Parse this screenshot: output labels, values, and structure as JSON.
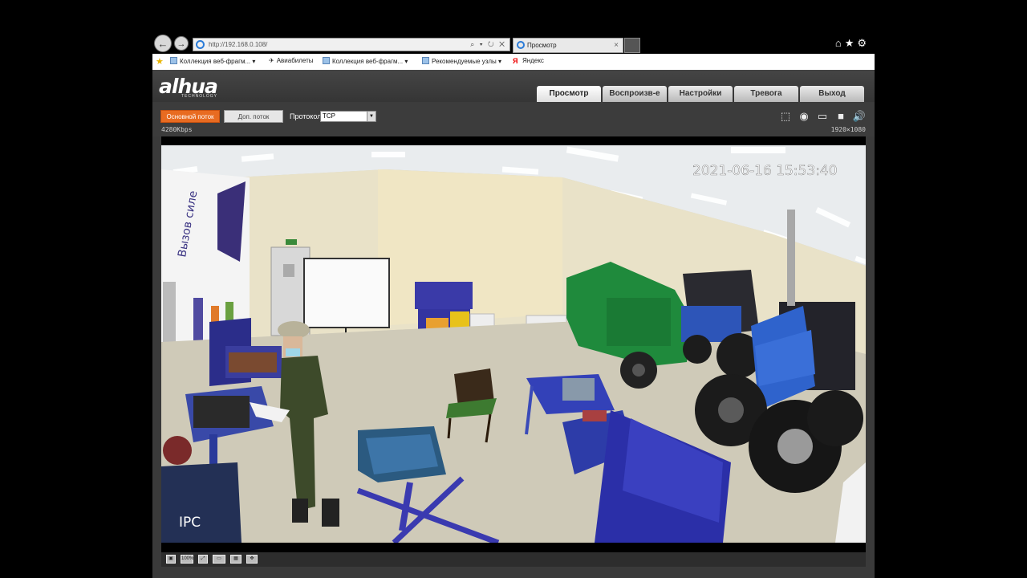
{
  "browser": {
    "url": "http://192.168.0.108/",
    "address_tools": "⌕ ▾ ↻ ✕",
    "tab_title": "Просмотр",
    "tab_close": "×",
    "back_icon": "←",
    "forward_icon": "→",
    "home_icon": "⌂",
    "star_icon": "★",
    "gear_icon": "⚙",
    "favorites": [
      {
        "label": "Коллекция веб-фрагм..."
      },
      {
        "label": "Авиабилеты"
      },
      {
        "label": "Коллекция веб-фрагм..."
      },
      {
        "label": "Рекомендуемые узлы"
      },
      {
        "label": "Яндекс"
      }
    ]
  },
  "app": {
    "logo": "alhua",
    "logo_sub": "TECHNOLOGY",
    "tabs": [
      "Просмотр",
      "Воспроизв-е",
      "Настройки",
      "Тревога",
      "Выход"
    ],
    "active_tab": "Просмотр",
    "main_stream": "Основной поток",
    "sub_stream": "Доп. поток",
    "protocol_label": "Протокол",
    "protocol_value": "TCP",
    "bitrate": "4280Kbps",
    "resolution": "1920×1080",
    "accent": "#e86b21"
  },
  "video": {
    "timestamp": "2021-06-16 15:53:40",
    "camera_label": "IPC"
  },
  "bottom_bar": {
    "zoom": "100%"
  }
}
